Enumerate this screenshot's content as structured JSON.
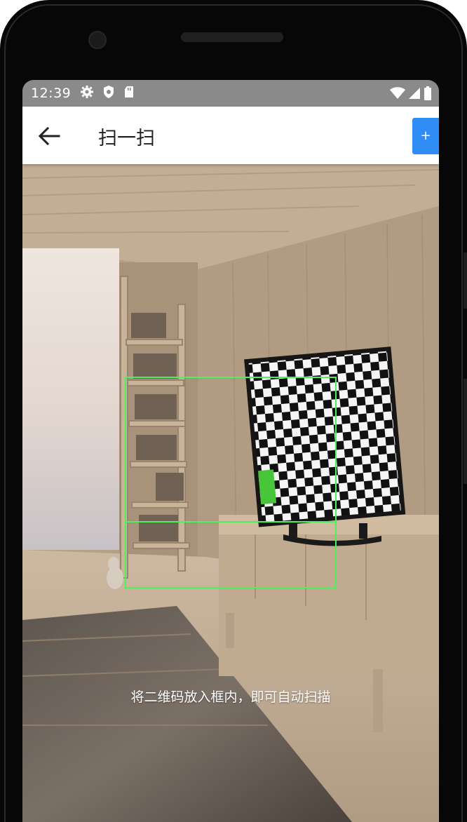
{
  "status_bar": {
    "time": "12:39",
    "left_icons": [
      "gear-icon",
      "shield-icon",
      "sd-card-icon"
    ],
    "right_icons": [
      "wifi-icon",
      "signal-icon",
      "battery-icon"
    ]
  },
  "app_bar": {
    "title": "扫一扫",
    "back_icon": "arrow-left-icon",
    "action_label": "+",
    "action_color": "#2f8df5"
  },
  "scanner": {
    "hint": "将二维码放入框内，即可自动扫描",
    "frame_color": "#4ef05b"
  }
}
